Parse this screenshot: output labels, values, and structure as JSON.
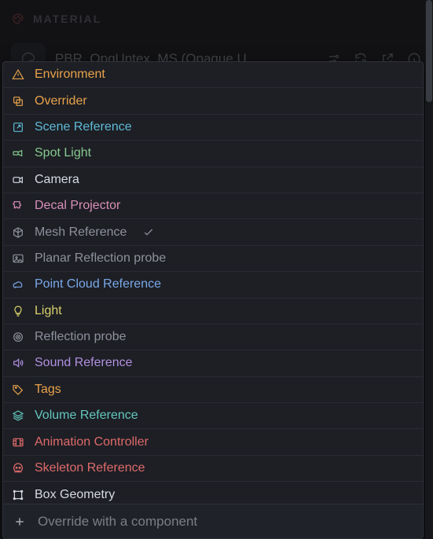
{
  "header": {
    "label": "MATERIAL"
  },
  "sub": {
    "title": "PBR_OpqUntex_MS (Opaque U…"
  },
  "menu": [
    {
      "name": "environment",
      "label": "Environment",
      "color": "c-orange",
      "icon": "triangle-warn-icon",
      "checked": false
    },
    {
      "name": "overrider",
      "label": "Overrider",
      "color": "c-orange",
      "icon": "copy-icon",
      "checked": false
    },
    {
      "name": "scene-reference",
      "label": "Scene Reference",
      "color": "c-cyan",
      "icon": "arrow-out-icon",
      "checked": false
    },
    {
      "name": "spot-light",
      "label": "Spot Light",
      "color": "c-green",
      "icon": "spotlight-icon",
      "checked": false
    },
    {
      "name": "camera",
      "label": "Camera",
      "color": "c-white",
      "icon": "camera-icon",
      "checked": false
    },
    {
      "name": "decal-projector",
      "label": "Decal Projector",
      "color": "c-pink",
      "icon": "puzzle-icon",
      "checked": false
    },
    {
      "name": "mesh-reference",
      "label": "Mesh Reference",
      "color": "c-grey",
      "icon": "cube-outline-icon",
      "checked": true
    },
    {
      "name": "planar-reflection",
      "label": "Planar Reflection probe",
      "color": "c-grey",
      "icon": "image-icon",
      "checked": false
    },
    {
      "name": "point-cloud-ref",
      "label": "Point Cloud Reference",
      "color": "c-blue",
      "icon": "cloud-icon",
      "checked": false
    },
    {
      "name": "light",
      "label": "Light",
      "color": "c-yellow",
      "icon": "bulb-icon",
      "checked": false
    },
    {
      "name": "reflection-probe",
      "label": "Reflection probe",
      "color": "c-grey",
      "icon": "target-icon",
      "checked": false
    },
    {
      "name": "sound-reference",
      "label": "Sound Reference",
      "color": "c-purple",
      "icon": "speaker-icon",
      "checked": false
    },
    {
      "name": "tags",
      "label": "Tags",
      "color": "c-orange",
      "icon": "tag-icon",
      "checked": false
    },
    {
      "name": "volume-reference",
      "label": "Volume Reference",
      "color": "c-teal",
      "icon": "layers-icon",
      "checked": false
    },
    {
      "name": "animation-ctrl",
      "label": "Animation Controller",
      "color": "c-red",
      "icon": "film-icon",
      "checked": false
    },
    {
      "name": "skeleton-ref",
      "label": "Skeleton Reference",
      "color": "c-red",
      "icon": "skull-icon",
      "checked": false
    },
    {
      "name": "box-geometry",
      "label": "Box Geometry",
      "color": "c-white",
      "icon": "bbox-icon",
      "checked": false
    }
  ],
  "search": {
    "placeholder": "Override with a component"
  }
}
